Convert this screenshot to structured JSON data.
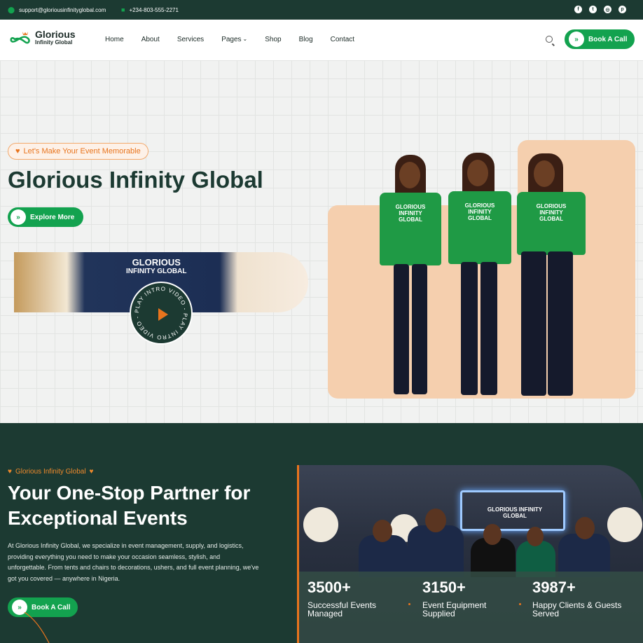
{
  "topbar": {
    "email": "support@gloriousinfinityglobal.com",
    "phone": "+234-803-555-2271",
    "social_icons": [
      "facebook-icon",
      "twitter-icon",
      "instagram-icon",
      "pinterest-icon"
    ]
  },
  "header": {
    "logo_name": "Glorious",
    "logo_sub": "Infinity Global",
    "nav": [
      "Home",
      "About",
      "Services",
      "Pages",
      "Shop",
      "Blog",
      "Contact"
    ],
    "pages_caret": "⌄",
    "cta": "Book A Call"
  },
  "hero": {
    "tagline": "Let's Make Your Event Memorable",
    "title": "Glorious Infinity Global",
    "cta": "Explore More",
    "video_title_line1": "GLORIOUS",
    "video_title_line2": "INFINITY GLOBAL",
    "play_ring_text": "PLAY INTRO VIDEO - PLAY INTRO VIDEO - ",
    "shirt_text_line1": "GLORIOUS",
    "shirt_text_line2": "INFINITY",
    "shirt_text_line3": "GLOBAL"
  },
  "about": {
    "kicker": "Glorious Infinity Global",
    "heading": "Your One-Stop Partner for Exceptional Events",
    "paragraph": "At Glorious Infinity Global, we specialize in event management, supply, and logistics, providing everything you need to make your occasion seamless, stylish, and unforgettable. From tents and chairs to decorations, ushers, and full event planning, we've got you covered — anywhere in Nigeria.",
    "cta": "Book A Call",
    "screen_text_line1": "GLORIOUS INFINITY",
    "screen_text_line2": "GLOBAL",
    "stats": [
      {
        "number": "3500+",
        "label": "Successful Events Managed"
      },
      {
        "number": "3150+",
        "label": "Event Equipment Supplied"
      },
      {
        "number": "3987+",
        "label": "Happy Clients & Guests Served"
      }
    ]
  },
  "colors": {
    "dark_green": "#1c3a32",
    "brand_green": "#13a24f",
    "accent_orange": "#e8741d",
    "peach": "#f5cfae"
  }
}
